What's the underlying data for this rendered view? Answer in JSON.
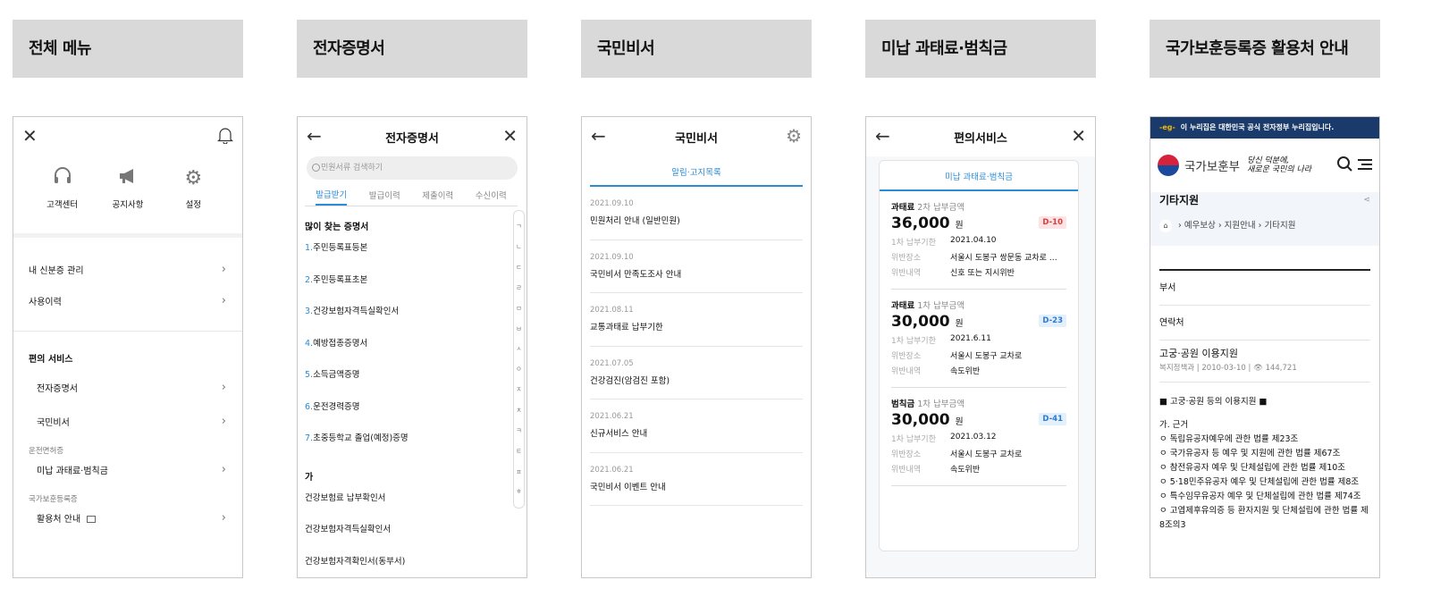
{
  "panels": [
    {
      "header": "전체 메뉴"
    },
    {
      "header": "전자증명서"
    },
    {
      "header": "국민비서"
    },
    {
      "header": "미납 과태료·범칙금"
    },
    {
      "header": "국가보훈등록증 활용처 안내"
    }
  ],
  "menu": {
    "icons": [
      {
        "label": "고객센터",
        "icon": "headset-icon"
      },
      {
        "label": "공지사항",
        "icon": "megaphone-icon"
      },
      {
        "label": "설정",
        "icon": "gear-icon"
      }
    ],
    "rows": [
      "내 신분증 관리",
      "사용이력"
    ],
    "section": "편의 서비스",
    "sub": [
      "전자증명서",
      "국민비서"
    ],
    "cat1": "운전면허증",
    "cat1_item": "미납 과태료·범칙금",
    "cat2": "국가보훈등록증",
    "cat2_item": "활용처 안내"
  },
  "cert": {
    "title": "전자증명서",
    "search_placeholder": "민원서류 검색하기",
    "tabs": [
      "발급받기",
      "발급이력",
      "제출이력",
      "수신이력"
    ],
    "section1": "많이 찾는 증명서",
    "popular": [
      {
        "n": "1.",
        "t": "주민등록표등본"
      },
      {
        "n": "2.",
        "t": "주민등록표초본"
      },
      {
        "n": "3.",
        "t": "건강보험자격득실확인서"
      },
      {
        "n": "4.",
        "t": "예방접종증명서"
      },
      {
        "n": "5.",
        "t": "소득금액증명"
      },
      {
        "n": "6.",
        "t": "운전경력증명"
      },
      {
        "n": "7.",
        "t": "초중등학교 졸업(예정)증명"
      }
    ],
    "section2": "가",
    "ga_items": [
      "건강보험료 납부확인서",
      "건강보험자격득실확인서",
      "건강보험자격확인서(동부서)"
    ],
    "index": [
      "ㄱ",
      "ㄴ",
      "ㄷ",
      "ㄹ",
      "ㅁ",
      "ㅂ",
      "ㅅ",
      "ㅇ",
      "ㅈ",
      "ㅊ",
      "ㅋ",
      "ㅌ",
      "ㅍ",
      "ㅎ"
    ]
  },
  "secretary": {
    "title": "국민비서",
    "tab": "알림·고지목록",
    "items": [
      {
        "date": "2021.09.10",
        "title": "민원처리 안내 (일반민원)"
      },
      {
        "date": "2021.09.10",
        "title": "국민비서 만족도조사 안내"
      },
      {
        "date": "2021.08.11",
        "title": "교통과태료 납부기한"
      },
      {
        "date": "2021.07.05",
        "title": "건강검진(암검진 포함)"
      },
      {
        "date": "2021.06.21",
        "title": "신규서비스 안내"
      },
      {
        "date": "2021.06.21",
        "title": "국민비서 이벤트 안내"
      }
    ]
  },
  "fines": {
    "title": "편의서비스",
    "tab": "미납 과태료·범칙금",
    "blocks": [
      {
        "kind": "과태료",
        "round": "2차 납부금액",
        "amount": "36,000",
        "unit": "원",
        "dday": "D-10",
        "badge_bg": "#fde4e4",
        "badge_fg": "#e03a3a",
        "kv": [
          [
            "1차 납부기한",
            "2021.04.10"
          ],
          [
            "위반장소",
            "서울시 도봉구 쌍문동 교차로 …"
          ],
          [
            "위반내역",
            "신호 또는 지시위반"
          ]
        ]
      },
      {
        "kind": "과태료",
        "round": "1차 납부금액",
        "amount": "30,000",
        "unit": "원",
        "dday": "D-23",
        "badge_bg": "#e3effb",
        "badge_fg": "#2a7bd6",
        "kv": [
          [
            "1차 납부기한",
            "2021.6.11"
          ],
          [
            "위반장소",
            "서울시 도봉구 교차로"
          ],
          [
            "위반내역",
            "속도위반"
          ]
        ]
      },
      {
        "kind": "범칙금",
        "round": "1차 납부금액",
        "amount": "30,000",
        "unit": "원",
        "dday": "D-41",
        "badge_bg": "#e3effb",
        "badge_fg": "#2a7bd6",
        "kv": [
          [
            "1차 납부기한",
            "2021.03.12"
          ],
          [
            "위반장소",
            "서울시 도봉구 교차로"
          ],
          [
            "위반내역",
            "속도위반"
          ]
        ]
      }
    ]
  },
  "veteran": {
    "gov_banner": "이 누리집은 대한민국 공식 전자정부 누리집입니다.",
    "org": "국가보훈부",
    "slogan1": "당신 덕분에,",
    "slogan2": "새로운 국민의 나라",
    "page_title": "기타지원",
    "breadcrumb": [
      "예우보상",
      "지원안내",
      "기타지원"
    ],
    "rows": [
      "부서",
      "연락처"
    ],
    "post_title": "고궁·공원 이용지원",
    "post_dept": "복지정책과",
    "post_date": "2010-03-10",
    "post_views": "144,721",
    "body": [
      "■ 고궁·공원 등의 이용지원 ■",
      "",
      "가. 근거",
      " ㅇ 독립유공자예우에 관한 법률 제23조",
      " ㅇ 국가유공자 등 예우 및 지원에 관한 법률 제67조",
      " ㅇ 참전유공자 예우 및 단체설립에 관한 법률 제10조",
      " ㅇ 5·18민주유공자 예우 및 단체설립에 관한 법률 제8조",
      " ㅇ 특수임무유공자 예우 및 단체설립에 관한 법률 제74조",
      " ㅇ 고엽제후유의증 등 환자지원 및 단체설립에 관한 법률 제8조의3"
    ]
  }
}
